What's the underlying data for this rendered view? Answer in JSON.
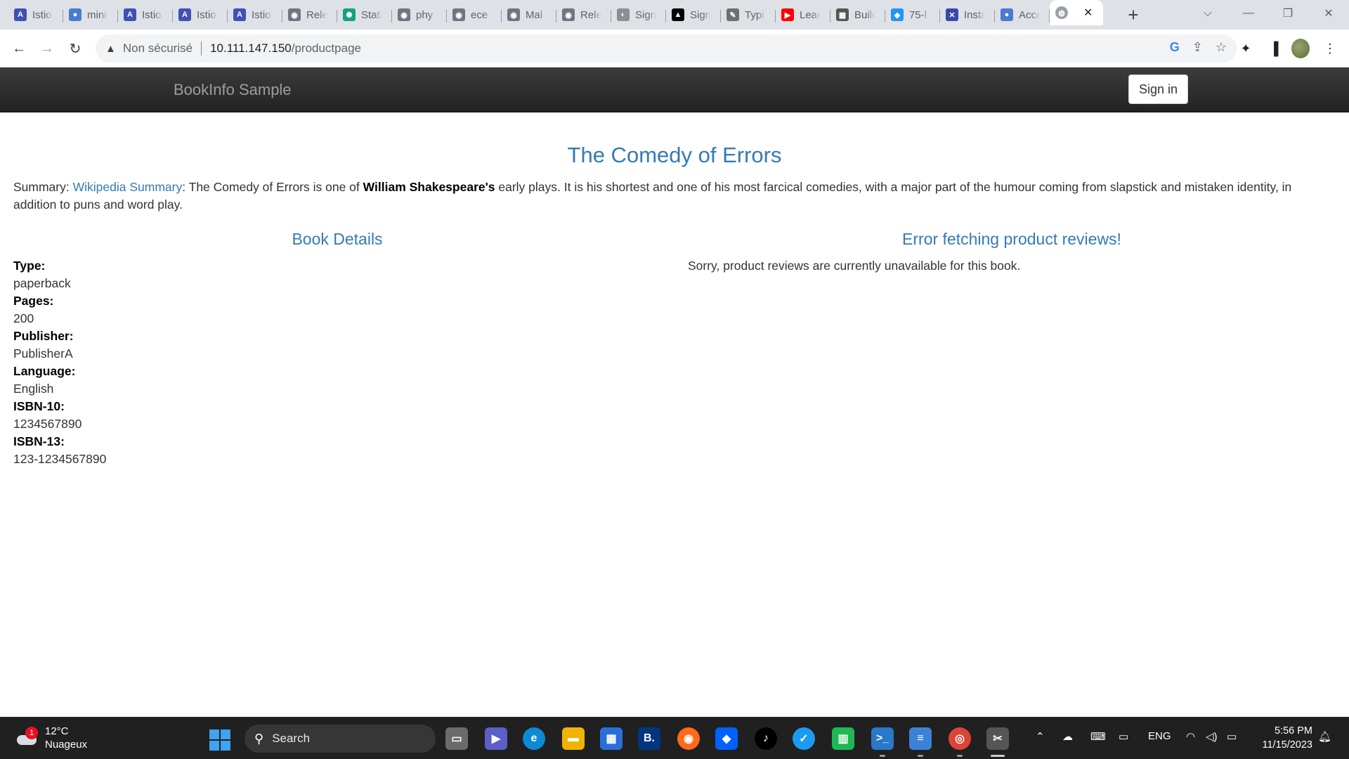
{
  "browser": {
    "tabs": [
      {
        "label": "Istio",
        "color": "#3f51b5",
        "glyph": "A"
      },
      {
        "label": "mini",
        "color": "#4a7bd0",
        "glyph": "●"
      },
      {
        "label": "Istio",
        "color": "#3f51b5",
        "glyph": "A"
      },
      {
        "label": "Istio",
        "color": "#3f51b5",
        "glyph": "A"
      },
      {
        "label": "Istio",
        "color": "#3f51b5",
        "glyph": "A"
      },
      {
        "label": "Rele",
        "color": "#6e7681",
        "glyph": "◉"
      },
      {
        "label": "Stati",
        "color": "#10a37f",
        "glyph": "✺"
      },
      {
        "label": "phy",
        "color": "#6e7681",
        "glyph": "◉"
      },
      {
        "label": "ece",
        "color": "#6e7681",
        "glyph": "◉"
      },
      {
        "label": "Mal",
        "color": "#6e7681",
        "glyph": "◉"
      },
      {
        "label": "Rele",
        "color": "#6e7681",
        "glyph": "◉"
      },
      {
        "label": "Sign",
        "color": "#8a8f95",
        "glyph": "◐"
      },
      {
        "label": "Sign",
        "color": "#000000",
        "glyph": "▲"
      },
      {
        "label": "Typi",
        "color": "#707070",
        "glyph": "✎"
      },
      {
        "label": "Lear",
        "color": "#ff0000",
        "glyph": "▶"
      },
      {
        "label": "Builc",
        "color": "#555555",
        "glyph": "▦"
      },
      {
        "label": "75-l",
        "color": "#2196f3",
        "glyph": "◆"
      },
      {
        "label": "Insta",
        "color": "#3949ab",
        "glyph": "✕"
      },
      {
        "label": "Acce",
        "color": "#4a7bd0",
        "glyph": "●"
      }
    ],
    "active_tab_close": "✕",
    "new_tab": "+",
    "url_warning": "Non sécurisé",
    "url_host": "10.111.147.150",
    "url_path": "/productpage"
  },
  "page": {
    "brand": "BookInfo Sample",
    "signin_label": "Sign in",
    "title": "The Comedy of Errors",
    "summary_prefix": "Summary: ",
    "summary_link": "Wikipedia Summary",
    "summary_mid": ": The Comedy of Errors is one of ",
    "summary_bold": "William Shakespeare's",
    "summary_rest": " early plays. It is his shortest and one of his most farcical comedies, with a major part of the humour coming from slapstick and mistaken identity, in addition to puns and word play.",
    "details_heading": "Book Details",
    "details": [
      {
        "label": "Type:",
        "value": "paperback"
      },
      {
        "label": "Pages:",
        "value": "200"
      },
      {
        "label": "Publisher:",
        "value": "PublisherA"
      },
      {
        "label": "Language:",
        "value": "English"
      },
      {
        "label": "ISBN-10:",
        "value": "1234567890"
      },
      {
        "label": "ISBN-13:",
        "value": "123-1234567890"
      }
    ],
    "reviews_heading": "Error fetching product reviews!",
    "reviews_message": "Sorry, product reviews are currently unavailable for this book."
  },
  "taskbar": {
    "weather_badge": "1",
    "temperature": "12°C",
    "condition": "Nuageux",
    "search_label": "Search",
    "language": "ENG",
    "time": "5:56 PM",
    "date": "11/15/2023"
  }
}
